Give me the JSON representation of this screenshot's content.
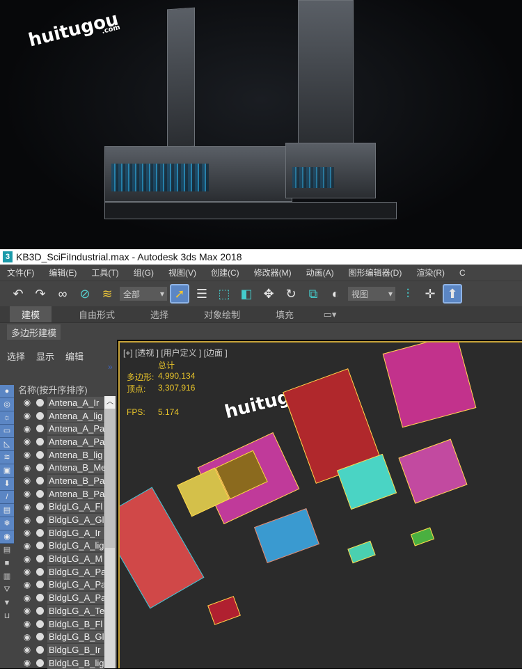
{
  "watermark": {
    "brand": "huitugou",
    "domain": ".com"
  },
  "window": {
    "title": "KB3D_SciFiIndustrial.max - Autodesk 3ds Max 2018",
    "app_icon": "3"
  },
  "menu": [
    "文件(F)",
    "编辑(E)",
    "工具(T)",
    "组(G)",
    "视图(V)",
    "创建(C)",
    "修改器(M)",
    "动画(A)",
    "图形编辑器(D)",
    "渲染(R)",
    "C"
  ],
  "toolbar": {
    "selection_filter": "全部",
    "view_dropdown": "视图"
  },
  "ribbon": {
    "tabs": [
      "建模",
      "自由形式",
      "选择",
      "对象绘制",
      "填充"
    ],
    "active": "建模",
    "subtab": "多边形建模"
  },
  "scene_explorer": {
    "menu": [
      "选择",
      "显示",
      "编辑"
    ],
    "column_header": "名称(按升序排序)",
    "items": [
      "Antena_A_Ir",
      "Antena_A_lig",
      "Antena_A_Pa",
      "Antena_A_Pa",
      "Antena_B_lig",
      "Antena_B_Me",
      "Antena_B_Pa",
      "Antena_B_Pa",
      "BldgLG_A_Fl",
      "BldgLG_A_Gl",
      "BldgLG_A_Ir",
      "BldgLG_A_lig",
      "BldgLG_A_M",
      "BldgLG_A_Pa",
      "BldgLG_A_Pa",
      "BldgLG_A_Pa",
      "BldgLG_A_Te",
      "BldgLG_B_Fl",
      "BldgLG_B_Gl",
      "BldgLG_B_Ir",
      "BldgLG_B_lig"
    ]
  },
  "viewport": {
    "label": "[+] [透视 ] [用户定义 ] [边面 ]",
    "stats_header": "总计",
    "polygons_label": "多边形:",
    "polygons": "4,990,134",
    "vertices_label": "顶点:",
    "vertices": "3,307,916",
    "fps_label": "FPS:",
    "fps": "5.174"
  },
  "colors": {
    "accent": "#5b86c4",
    "stats": "#e6c22a",
    "viewport_border": "#c8a43a"
  }
}
